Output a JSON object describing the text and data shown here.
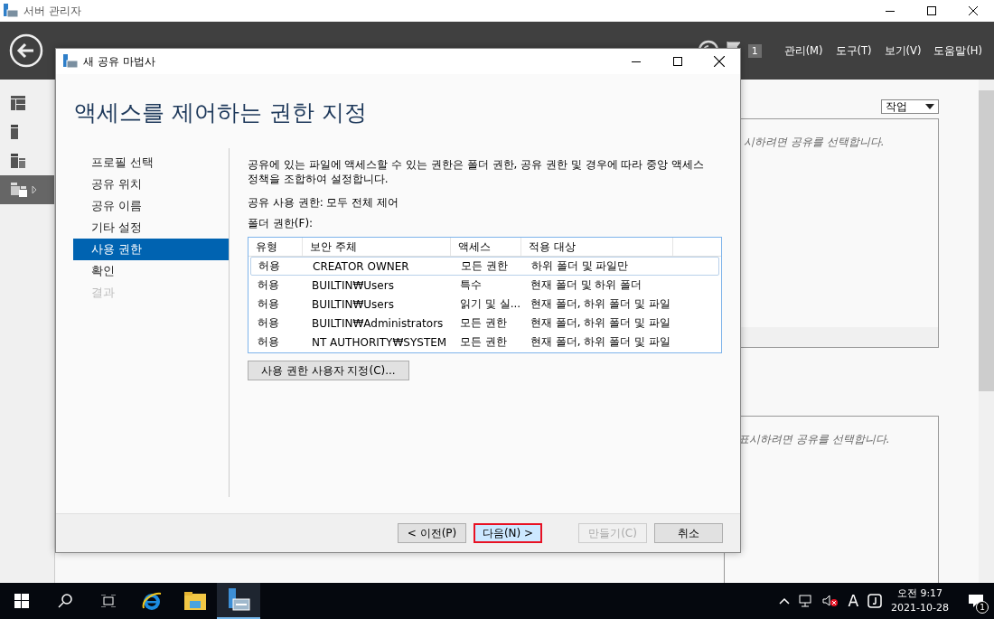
{
  "window": {
    "title": "서버 관리자"
  },
  "header": {
    "menus": [
      "관리(M)",
      "도구(T)",
      "보기(V)",
      "도움말(H)"
    ],
    "flag_count": "1"
  },
  "sidebar": {
    "items": [
      {
        "selected": false
      },
      {
        "selected": false
      },
      {
        "selected": false
      },
      {
        "selected": true
      }
    ]
  },
  "background": {
    "tasks_button": "작업",
    "hints": [
      "시하려면 공유를 선택합니다.",
      "표시하려면 공유를 선택합니다."
    ]
  },
  "dialog": {
    "title": "새 공유 마법사",
    "heading": "액세스를 제어하는 권한 지정",
    "steps": [
      {
        "label": "프로필 선택",
        "selected": false,
        "disabled": false
      },
      {
        "label": "공유 위치",
        "selected": false,
        "disabled": false
      },
      {
        "label": "공유 이름",
        "selected": false,
        "disabled": false
      },
      {
        "label": "기타 설정",
        "selected": false,
        "disabled": false
      },
      {
        "label": "사용 권한",
        "selected": true,
        "disabled": false
      },
      {
        "label": "확인",
        "selected": false,
        "disabled": false
      },
      {
        "label": "결과",
        "selected": false,
        "disabled": true
      }
    ],
    "description": "공유에 있는 파일에 액세스할 수 있는 권한은 폴더 권한, 공유 권한 및 경우에 따라 중앙 액세스 정책을 조합하여 설정합니다.",
    "share_permissions": "공유 사용 권한: 모두 전체 제어",
    "folder_permissions_label": "폴더 권한(F):",
    "table": {
      "columns": [
        "유형",
        "보안 주체",
        "액세스",
        "적용 대상"
      ],
      "rows": [
        {
          "cells": [
            "허용",
            "CREATOR OWNER",
            "모든 권한",
            "하위 폴더 및 파일만"
          ],
          "selected": true
        },
        {
          "cells": [
            "허용",
            "BUILTIN₩Users",
            "특수",
            "현재 폴더 및 하위 폴더"
          ],
          "selected": false
        },
        {
          "cells": [
            "허용",
            "BUILTIN₩Users",
            "읽기 및 실...",
            "현재 폴더, 하위 폴더 및 파일"
          ],
          "selected": false
        },
        {
          "cells": [
            "허용",
            "BUILTIN₩Administrators",
            "모든 권한",
            "현재 폴더, 하위 폴더 및 파일"
          ],
          "selected": false
        },
        {
          "cells": [
            "허용",
            "NT AUTHORITY₩SYSTEM",
            "모든 권한",
            "현재 폴더, 하위 폴더 및 파일"
          ],
          "selected": false
        }
      ]
    },
    "customize_button": "사용 권한 사용자 지정(C)...",
    "buttons": [
      {
        "label": "< 이전(P)",
        "disabled": false,
        "focused": false
      },
      {
        "label": "다음(N) >",
        "disabled": false,
        "focused": true
      },
      {
        "label": "만들기(C)",
        "disabled": true,
        "focused": false
      },
      {
        "label": "취소",
        "disabled": false,
        "focused": false
      }
    ]
  },
  "taskbar": {
    "apps": [
      {
        "active": false
      },
      {
        "active": false
      },
      {
        "active": true
      }
    ],
    "ime": "A",
    "time": "오전 9:17",
    "date": "2021-10-28",
    "notification_count": "1"
  }
}
